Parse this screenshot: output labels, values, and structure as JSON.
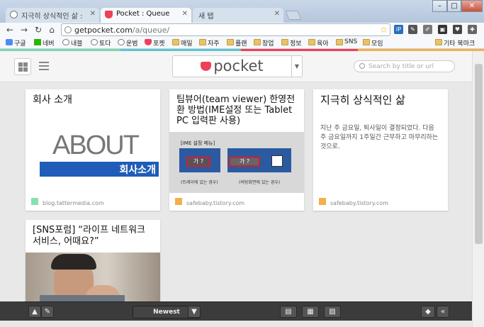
{
  "browser": {
    "tabs": [
      {
        "label": "지극히 상식적인 삶 :"
      },
      {
        "label": "Pocket : Queue"
      },
      {
        "label": "새 탭"
      }
    ],
    "url_host": "getpocket.com",
    "url_path": "/a/queue/",
    "window_min": "–",
    "window_max": "□",
    "window_close": "✕"
  },
  "bookmarks": [
    {
      "label": "구글"
    },
    {
      "label": "네버"
    },
    {
      "label": "내블"
    },
    {
      "label": "토다"
    },
    {
      "label": "운범"
    },
    {
      "label": "포켓"
    },
    {
      "label": "매일"
    },
    {
      "label": "자주"
    },
    {
      "label": "플랜"
    },
    {
      "label": "창업"
    },
    {
      "label": "정보"
    },
    {
      "label": "육아"
    },
    {
      "label": "SNS"
    },
    {
      "label": "모임"
    },
    {
      "label": "기타 북마크"
    }
  ],
  "pocket": {
    "logo_text": "pocket",
    "search_placeholder": "Search by title or url",
    "sort_label": "Newest"
  },
  "cards": [
    {
      "title": "회사 소개",
      "image_text_big": "ABOUT",
      "image_text_bar": "회사소개",
      "source": "blog.tattermedia.com",
      "source_color": "#88e0b0"
    },
    {
      "title": "팀뷰어(team viewer) 한영전환 방법(IME설정 또는 Tablet PC 입력판 사용)",
      "image_label": "[IME 설정 메뉴]",
      "image_caption_left": "(트레이에 있는 경우)",
      "image_caption_right": "(바탕화면에 있는 경우)",
      "source": "safebaby.tistory.com",
      "source_color": "#f4b04a"
    },
    {
      "title": "지극히 상식적인 삶",
      "excerpt": "지난 주 금요일, 퇴사일이 결정되었다. 다음 주 금요일까지 1주일간 근무하고 마무리하는 것으로.",
      "source": "safebaby.tistory.com",
      "source_color": "#f4b04a"
    },
    {
      "title": "[SNS포럼] “라이프 네트워크 서비스, 어때요?”"
    }
  ]
}
